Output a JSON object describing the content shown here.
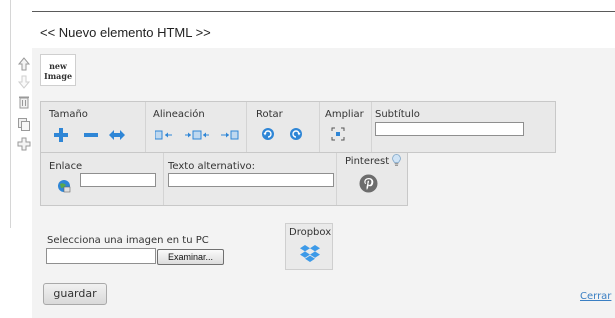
{
  "element": {
    "title": "<< Nuevo elemento HTML >>"
  },
  "side_tools": [
    {
      "icon": "move-up-icon"
    },
    {
      "icon": "move-down-icon"
    },
    {
      "icon": "trash-icon"
    },
    {
      "icon": "copy-icon"
    },
    {
      "icon": "add-icon"
    }
  ],
  "thumbnail": {
    "line1": "new",
    "line2": "Image"
  },
  "toolbar": {
    "size_label": "Tamaño",
    "align_label": "Alineación",
    "rotate_label": "Rotar",
    "zoom_label": "Ampliar",
    "subtitle_label": "Subtítulo",
    "subtitle_value": "",
    "link_label": "Enlace",
    "link_value": "",
    "alt_label": "Texto alternativo:",
    "alt_value": "",
    "pinterest_label": "Pinterest"
  },
  "upload": {
    "prompt": "Selecciona una imagen en tu PC",
    "file_value": "",
    "browse_label": "Examinar...",
    "dropbox_label": "Dropbox"
  },
  "actions": {
    "save_label": "guardar",
    "close_label": "Cerrar"
  },
  "colors": {
    "accent_blue": "#2f86d6",
    "link_blue": "#3a7fc3",
    "pinterest_gray": "#6d6d6d"
  }
}
